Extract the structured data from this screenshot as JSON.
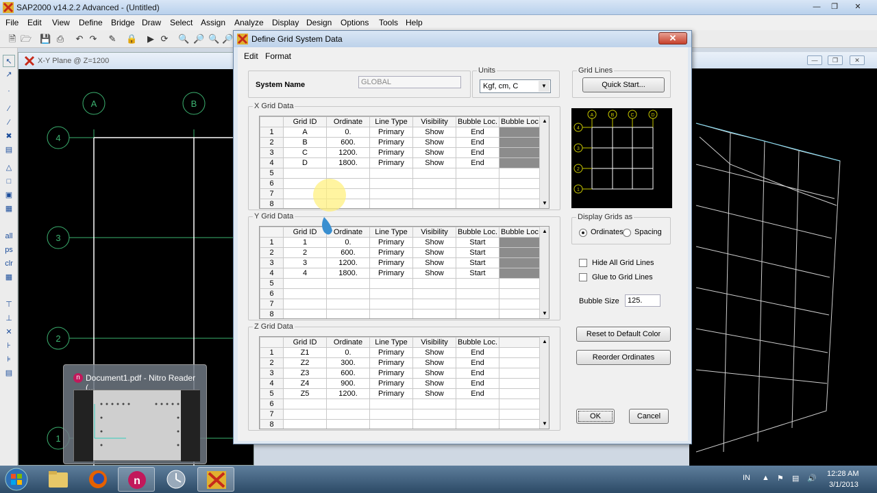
{
  "app": {
    "title": "SAP2000 v14.2.2 Advanced  - (Untitled)"
  },
  "menu": [
    "File",
    "Edit",
    "View",
    "Define",
    "Bridge",
    "Draw",
    "Select",
    "Assign",
    "Analyze",
    "Display",
    "Design",
    "Options",
    "Tools",
    "Help"
  ],
  "plane_window": {
    "title": "X-Y Plane @ Z=1200",
    "x_bubbles": [
      "A",
      "B"
    ],
    "y_bubbles": [
      "4",
      "3",
      "2",
      "1"
    ]
  },
  "nitro_popup": {
    "title": "Document1.pdf - Nitro Reader (..."
  },
  "dialog": {
    "title": "Define Grid System Data",
    "menu": [
      "Edit",
      "Format"
    ],
    "system_name_label": "System Name",
    "system_name_value": "GLOBAL",
    "units_label": "Units",
    "units_value": "Kgf, cm, C",
    "grid_lines_label": "Grid Lines",
    "quick_start_label": "Quick Start...",
    "x_grid_label": "X Grid Data",
    "y_grid_label": "Y Grid Data",
    "z_grid_label": "Z Grid Data",
    "columns": [
      "Grid ID",
      "Ordinate",
      "Line Type",
      "Visibility",
      "Bubble Loc.",
      "Bubble Loc."
    ],
    "z_columns": [
      "Grid ID",
      "Ordinate",
      "Line Type",
      "Visibility",
      "Bubble Loc."
    ],
    "x_rows": [
      [
        "1",
        "A",
        "0.",
        "Primary",
        "Show",
        "End"
      ],
      [
        "2",
        "B",
        "600.",
        "Primary",
        "Show",
        "End"
      ],
      [
        "3",
        "C",
        "1200.",
        "Primary",
        "Show",
        "End"
      ],
      [
        "4",
        "D",
        "1800.",
        "Primary",
        "Show",
        "End"
      ],
      [
        "5",
        "",
        "",
        "",
        "",
        ""
      ],
      [
        "6",
        "",
        "",
        "",
        "",
        ""
      ],
      [
        "7",
        "",
        "",
        "",
        "",
        ""
      ],
      [
        "8",
        "",
        "",
        "",
        "",
        ""
      ]
    ],
    "y_rows": [
      [
        "1",
        "1",
        "0.",
        "Primary",
        "Show",
        "Start"
      ],
      [
        "2",
        "2",
        "600.",
        "Primary",
        "Show",
        "Start"
      ],
      [
        "3",
        "3",
        "1200.",
        "Primary",
        "Show",
        "Start"
      ],
      [
        "4",
        "4",
        "1800.",
        "Primary",
        "Show",
        "Start"
      ],
      [
        "5",
        "",
        "",
        "",
        "",
        ""
      ],
      [
        "6",
        "",
        "",
        "",
        "",
        ""
      ],
      [
        "7",
        "",
        "",
        "",
        "",
        ""
      ],
      [
        "8",
        "",
        "",
        "",
        "",
        ""
      ]
    ],
    "z_rows": [
      [
        "1",
        "Z1",
        "0.",
        "Primary",
        "Show",
        "End"
      ],
      [
        "2",
        "Z2",
        "300.",
        "Primary",
        "Show",
        "End"
      ],
      [
        "3",
        "Z3",
        "600.",
        "Primary",
        "Show",
        "End"
      ],
      [
        "4",
        "Z4",
        "900.",
        "Primary",
        "Show",
        "End"
      ],
      [
        "5",
        "Z5",
        "1200.",
        "Primary",
        "Show",
        "End"
      ],
      [
        "6",
        "",
        "",
        "",
        "",
        ""
      ],
      [
        "7",
        "",
        "",
        "",
        "",
        ""
      ],
      [
        "8",
        "",
        "",
        "",
        "",
        ""
      ]
    ],
    "preview_top_bubbles": [
      "A",
      "B",
      "C",
      "D"
    ],
    "preview_side_bubbles": [
      "4",
      "3",
      "2",
      "1"
    ],
    "display_grids_label": "Display Grids as",
    "ordinates_label": "Ordinates",
    "spacing_label": "Spacing",
    "hide_all_label": "Hide All Grid Lines",
    "glue_label": "Glue to Grid Lines",
    "bubble_size_label": "Bubble Size",
    "bubble_size_value": "125.",
    "reset_color_label": "Reset to Default Color",
    "reorder_label": "Reorder Ordinates",
    "ok_label": "OK",
    "cancel_label": "Cancel"
  },
  "taskbar": {
    "lang": "IN",
    "time": "12:28 AM",
    "date": "3/1/2013"
  },
  "colors": {
    "grid_line": "#3cb371",
    "preview_bubble": "#c8c800",
    "wireframe": "#d0d0d0",
    "wireframe_accent": "#7ad7f0"
  }
}
